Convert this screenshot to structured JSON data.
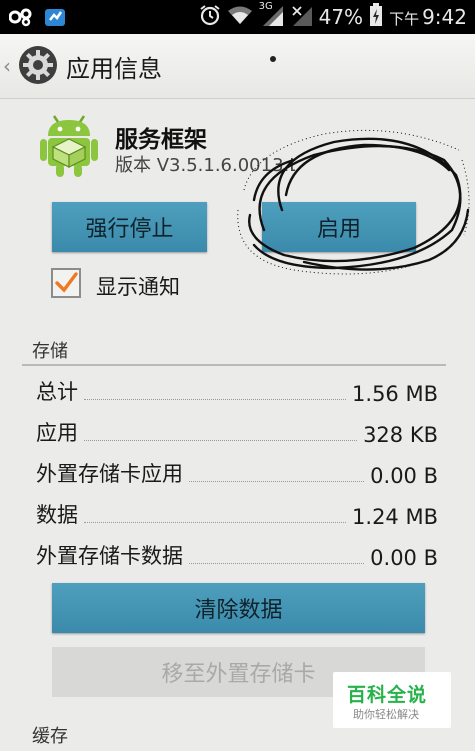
{
  "status_bar": {
    "battery_percent": "47%",
    "ampm": "下午",
    "time": "9:42",
    "network_label": "3G",
    "icons": [
      "pinwheel-app-icon",
      "flag-app-icon",
      "alarm-icon",
      "wifi-icon",
      "signal-3g-icon",
      "signal-blocked-icon",
      "battery-charging-icon"
    ]
  },
  "action_bar": {
    "title": "应用信息",
    "icon": "settings-gear-icon"
  },
  "app": {
    "name": "服务框架",
    "version": "版本 V3.5.1.6.0013.L",
    "icon": "android-package-icon"
  },
  "buttons": {
    "force_stop": "强行停止",
    "enable": "启用",
    "clear_data": "清除数据",
    "move_to_sd": "移至外置存储卡"
  },
  "notifications": {
    "label": "显示通知",
    "checked": true
  },
  "storage": {
    "title": "存储",
    "rows": [
      {
        "label": "总计",
        "value": "1.56 MB"
      },
      {
        "label": "应用",
        "value": "328 KB"
      },
      {
        "label": "外置存储卡应用",
        "value": "0.00 B"
      },
      {
        "label": "数据",
        "value": "1.24 MB"
      },
      {
        "label": "外置存储卡数据",
        "value": "0.00 B"
      }
    ]
  },
  "cache": {
    "title": "缓存"
  },
  "watermark": {
    "main": "百科全说",
    "sub": "助你轻松解决"
  },
  "colors": {
    "button_blue": "#4e9fbe",
    "checkbox_orange": "#f07820",
    "watermark_green": "#27b24a"
  }
}
